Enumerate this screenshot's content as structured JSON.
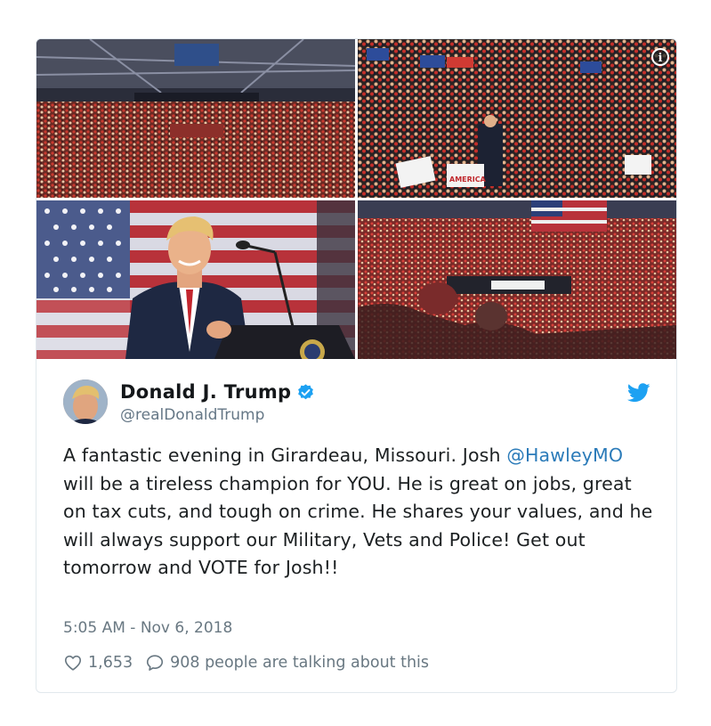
{
  "tweet": {
    "author_name": "Donald J. Trump",
    "author_handle": "@realDonaldTrump",
    "text_before": "A fantastic evening in Girardeau, Missouri. Josh ",
    "mention": "@HawleyMO",
    "text_after": " will be a tireless champion for YOU. He is great on jobs, great on tax cuts, and tough on crime. He shares your values, and he will always support our Military, Vets and Police! Get out tomorrow and VOTE for Josh!!",
    "timestamp": "5:05 AM - Nov 6, 2018",
    "likes": "1,653",
    "talking": "908 people are talking about this"
  },
  "media": {
    "info_label": "i",
    "sign_text": "AMERICA",
    "photos": [
      "arena-wide",
      "crowd-stage",
      "speaker-podium",
      "arena-crowd"
    ]
  },
  "colors": {
    "link": "#2b7bb9",
    "twitter_blue": "#1da1f2",
    "muted": "#697882"
  }
}
